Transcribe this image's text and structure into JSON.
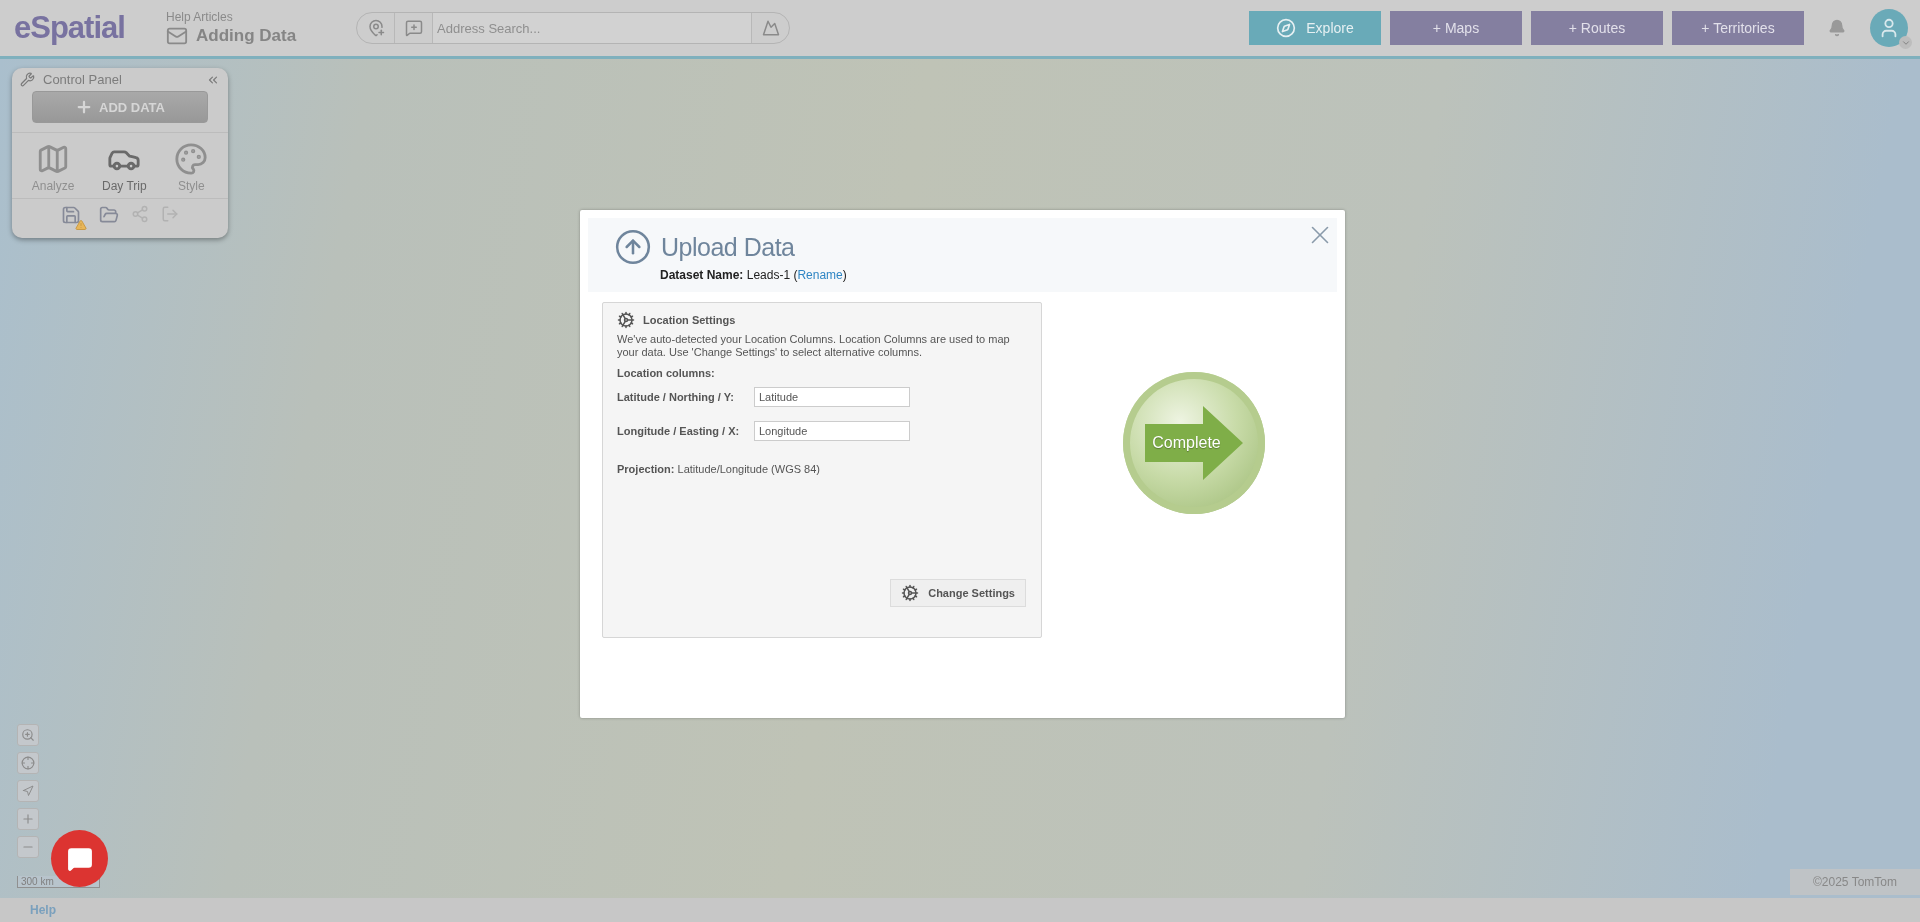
{
  "header": {
    "logo": "eSpatial",
    "help_articles": {
      "label": "Help Articles",
      "title": "Adding Data"
    },
    "search": {
      "placeholder": "Address Search..."
    },
    "nav_buttons": [
      {
        "label": "Explore",
        "selected": true
      },
      {
        "label": "+ Maps",
        "selected": false
      },
      {
        "label": "+ Routes",
        "selected": false
      },
      {
        "label": "+ Territories",
        "selected": false
      }
    ]
  },
  "control_panel": {
    "title": "Control Panel",
    "add_data_button": "ADD DATA",
    "tools": [
      {
        "label": "Analyze",
        "kind": "analyze",
        "disabled": true
      },
      {
        "label": "Day Trip",
        "kind": "car",
        "disabled": false
      },
      {
        "label": "Style",
        "kind": "palette",
        "disabled": true
      }
    ],
    "actions": [
      {
        "kind": "save",
        "disabled": false,
        "warning": true
      },
      {
        "kind": "open",
        "disabled": false,
        "warning": false
      },
      {
        "kind": "share",
        "disabled": true,
        "warning": false
      },
      {
        "kind": "export",
        "disabled": true,
        "warning": false
      }
    ]
  },
  "modal": {
    "title": "Upload Data",
    "dataset": {
      "label": "Dataset Name:",
      "before": "Leads-1 (",
      "link": "Rename",
      "after": ")"
    },
    "location_settings": {
      "title": "Location Settings",
      "description": "We've auto-detected your Location Columns. Location Columns are used to map your data. Use 'Change Settings' to select alternative columns.",
      "columns_label": "Location columns:",
      "fields": [
        {
          "label": "Latitude / Northing / Y:",
          "value": "Latitude"
        },
        {
          "label": "Longitude / Easting / X:",
          "value": "Longitude"
        }
      ],
      "projection": "**Projection:** Latitude/Longitude (WGS 84)",
      "change_settings_button": "Change Settings"
    },
    "complete_button": "Complete"
  },
  "map": {
    "scale": "300 km",
    "copyright": "©2025 TomTom"
  },
  "footer": {
    "help_link": "Help"
  }
}
